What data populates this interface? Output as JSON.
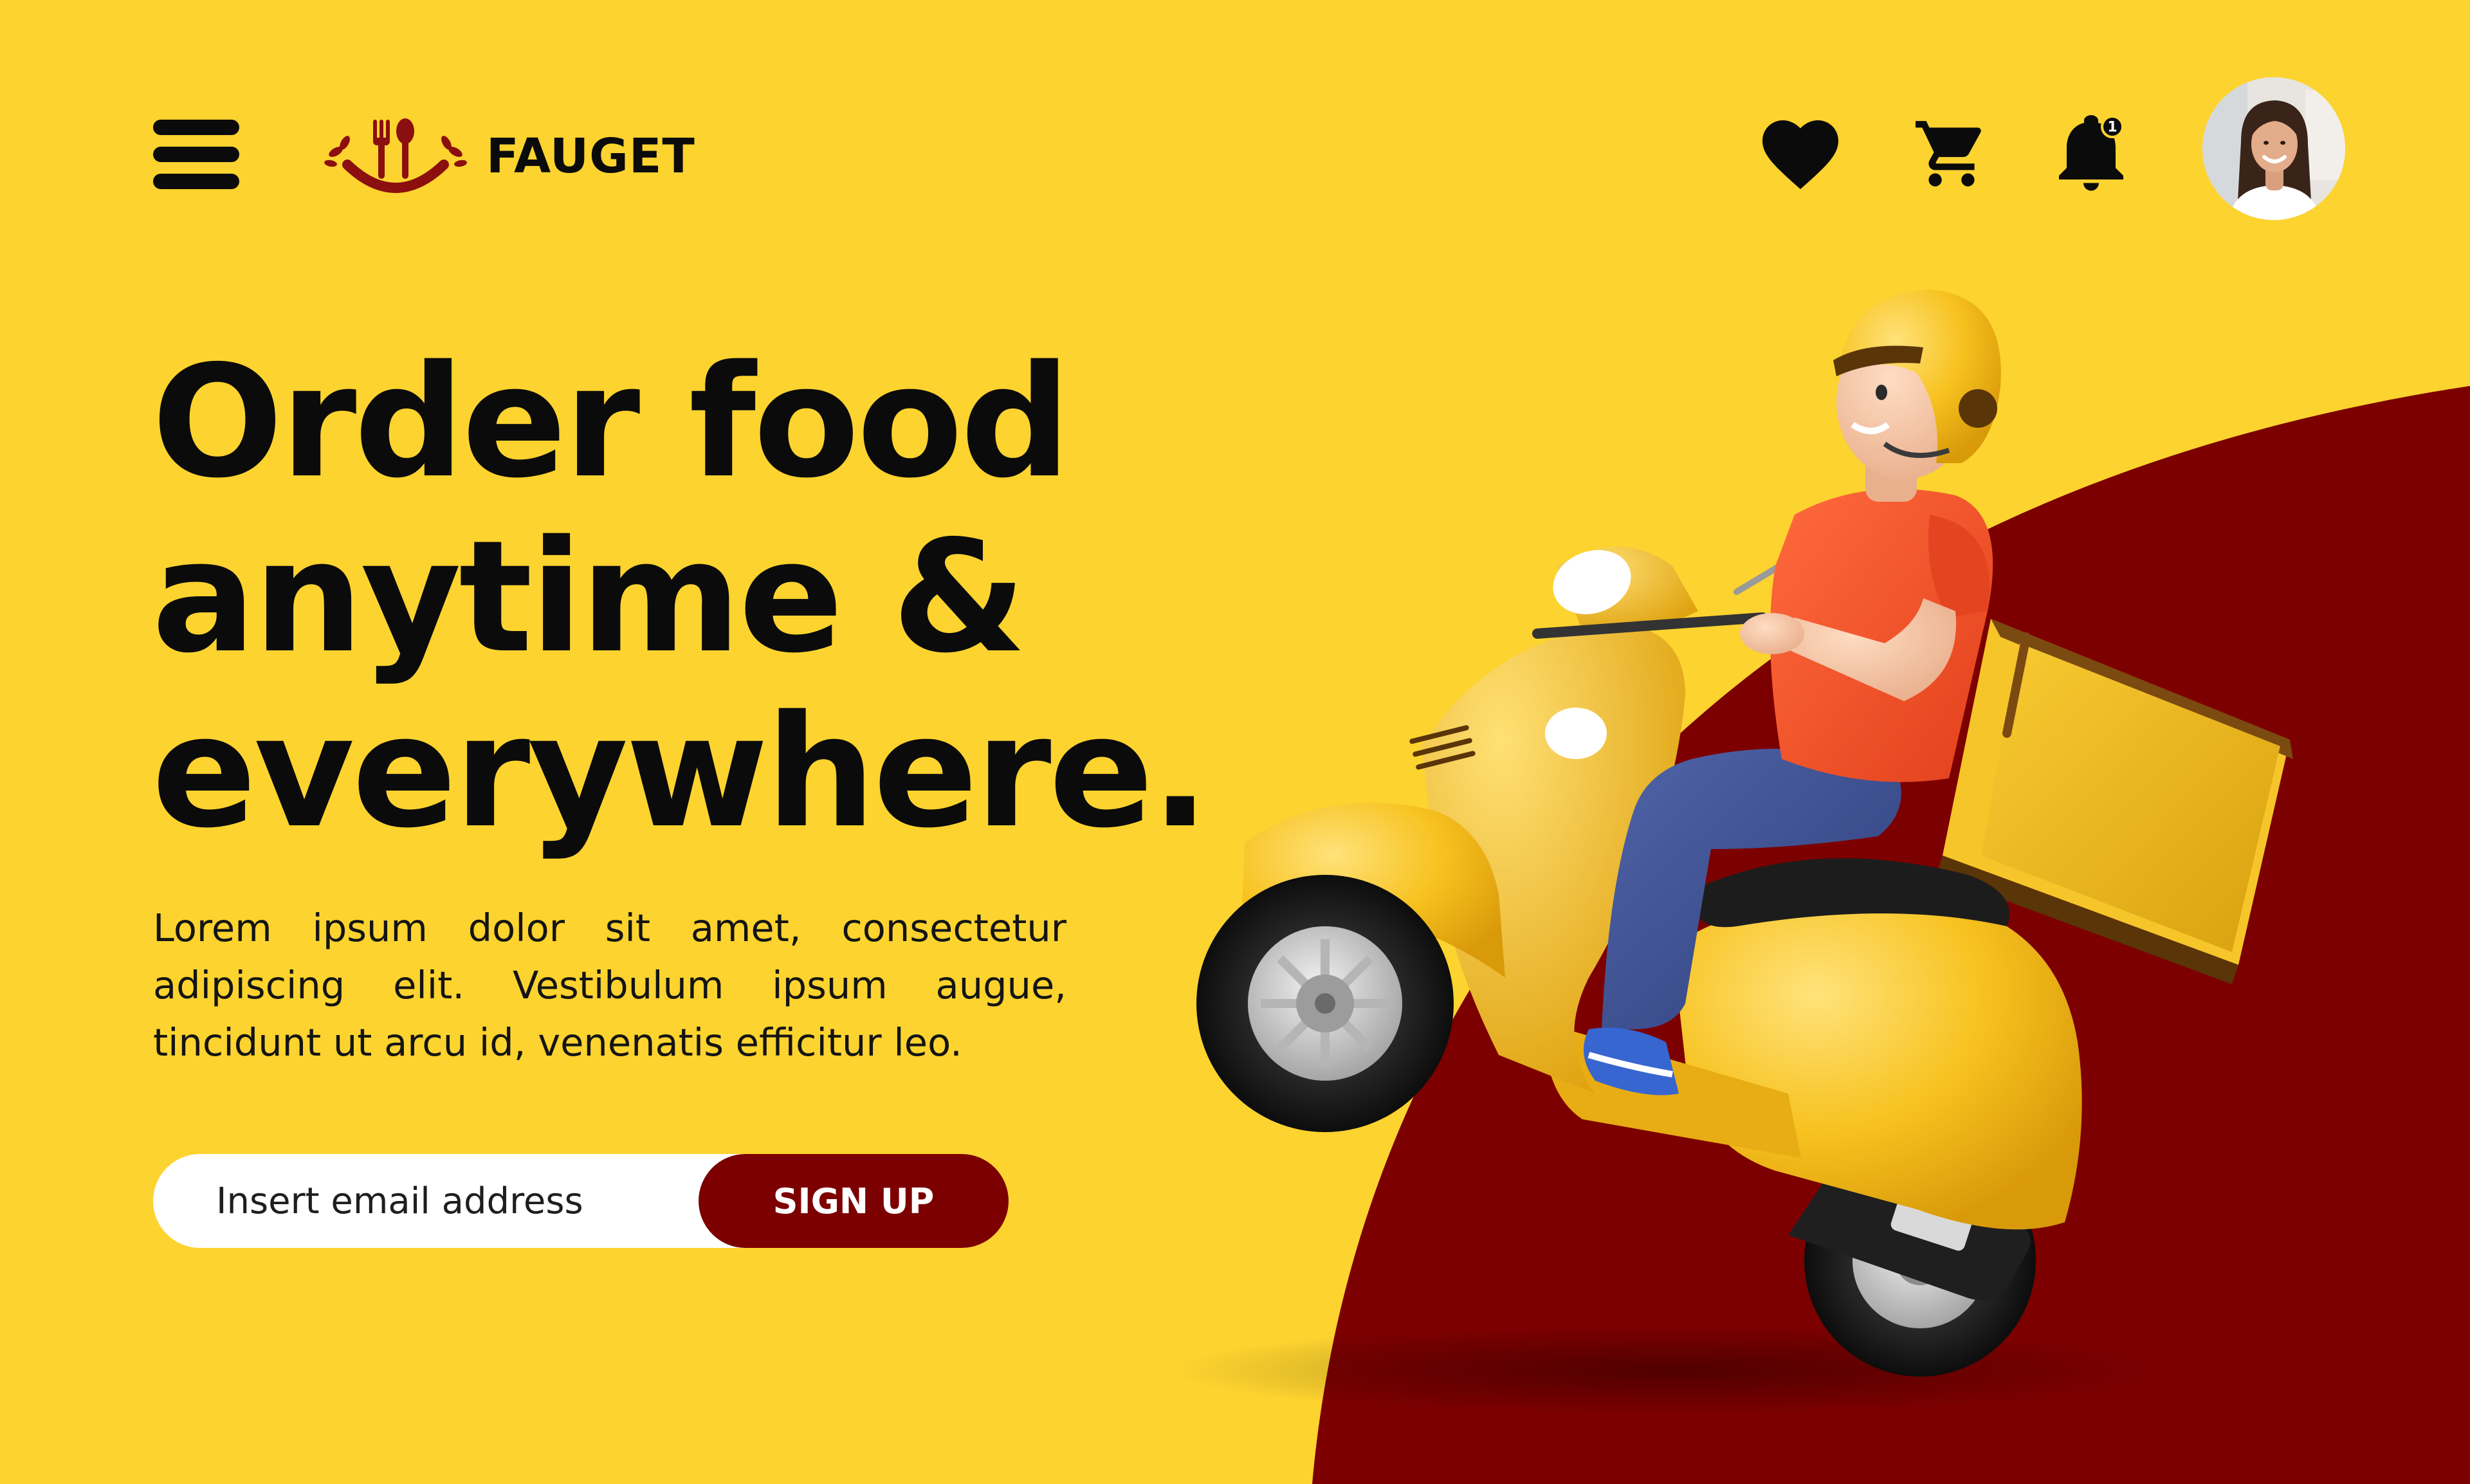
{
  "colors": {
    "background": "#FDD32F",
    "accent": "#7C0000",
    "text": "#0B0B0B",
    "input_background": "#FFFFFF"
  },
  "header": {
    "menu_icon": "hamburger-menu-icon",
    "brand": {
      "logo_icon": "fork-spoon-smile-logo-icon",
      "name": "FAUGET"
    },
    "actions": [
      {
        "icon": "heart-icon"
      },
      {
        "icon": "shopping-cart-icon"
      },
      {
        "icon": "bell-icon",
        "badge": "1"
      }
    ],
    "avatar_icon": "user-avatar"
  },
  "hero": {
    "headline": [
      "Order food",
      "anytime &",
      "everywhere."
    ],
    "description": "Lorem ipsum dolor sit amet, consectetur adipiscing elit. Vestibulum ipsum augue, tincidunt ut arcu id, venenatis efficitur leo.",
    "email_placeholder": "Insert email address",
    "email_value": "",
    "signup_label": "SIGN UP"
  },
  "illustration": {
    "subject": "delivery-rider-scooter-illustration"
  }
}
